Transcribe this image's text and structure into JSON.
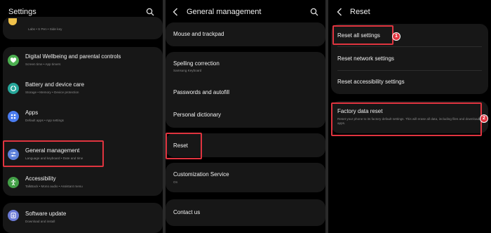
{
  "left": {
    "title": "Settings",
    "top_partial_sub": "Labs  •  S Pen  •  Side key",
    "items": [
      {
        "label": "Digital Wellbeing and parental controls",
        "sub": "Screen time  •  App timers",
        "icon": "wellbeing-icon",
        "color": "#4caf50"
      },
      {
        "label": "Battery and device care",
        "sub": "Storage  •  Memory  •  Device protection",
        "icon": "battery-care-icon",
        "color": "#26a69a"
      },
      {
        "label": "Apps",
        "sub": "Default apps  •  App settings",
        "icon": "apps-icon",
        "color": "#4a7cf0"
      },
      {
        "label": "General management",
        "sub": "Language and keyboard  •  Date and time",
        "icon": "sliders-icon",
        "color": "#5b7fd8"
      },
      {
        "label": "Accessibility",
        "sub": "TalkBack  •  Mono audio  •  Assistant menu",
        "icon": "accessibility-icon",
        "color": "#43a047"
      },
      {
        "label": "Software update",
        "sub": "Download and install",
        "icon": "software-update-icon",
        "color": "#6c7bd6"
      }
    ]
  },
  "middle": {
    "title": "General management",
    "items": [
      {
        "label": "Mouse and trackpad",
        "sub": ""
      },
      {
        "label": "Spelling correction",
        "sub": "Samsung Keyboard"
      },
      {
        "label": "Passwords and autofill",
        "sub": ""
      },
      {
        "label": "Personal dictionary",
        "sub": ""
      },
      {
        "label": "Reset",
        "sub": ""
      },
      {
        "label": "Customization Service",
        "sub": "On"
      },
      {
        "label": "Contact us",
        "sub": ""
      }
    ]
  },
  "right": {
    "title": "Reset",
    "items": [
      {
        "label": "Reset all settings",
        "sub": ""
      },
      {
        "label": "Reset network settings",
        "sub": ""
      },
      {
        "label": "Reset accessibility settings",
        "sub": ""
      },
      {
        "label": "Factory data reset",
        "sub": "Reset your phone to its factory default settings. This will erase all data, including files and downloaded apps."
      }
    ]
  },
  "badges": [
    "1",
    "2"
  ],
  "colors": {
    "highlight": "#e0343f",
    "card": "#171717",
    "background": "#000000"
  }
}
